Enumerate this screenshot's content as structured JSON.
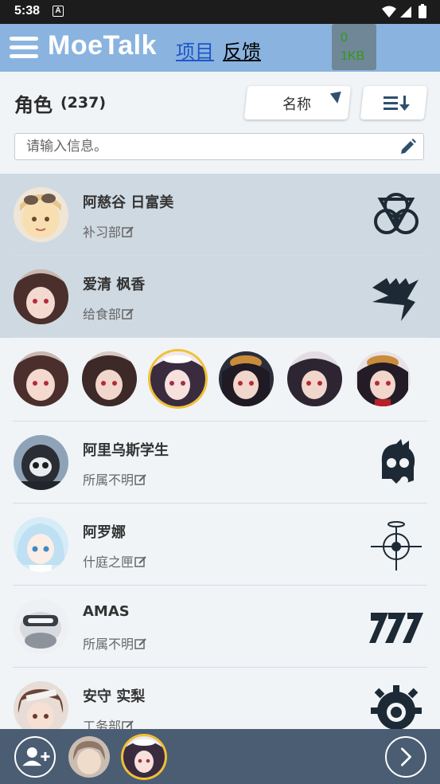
{
  "status_bar": {
    "time": "5:38",
    "notification_badge": "A",
    "icons": [
      "wifi-icon",
      "signal-icon",
      "battery-icon"
    ]
  },
  "header": {
    "logo": "MoeTalk",
    "nav_project": "项目",
    "nav_feedback": "反馈",
    "storage_value": "0",
    "storage_unit": "1KB"
  },
  "section": {
    "title": "角色",
    "count": "(237)",
    "sort_label": "名称"
  },
  "search": {
    "placeholder": "请输入信息。",
    "value": ""
  },
  "characters": [
    {
      "name": "阿慈谷 日富美",
      "club": "补习部",
      "selected": true,
      "avatar": "hifumi",
      "school_icon": "trinity-logo-icon"
    },
    {
      "name": "爱清 枫香",
      "club": "给食部",
      "selected": true,
      "avatar": "fuuka",
      "school_icon": "gehenna-logo-icon"
    },
    {
      "name": "阿里乌斯学生",
      "club": "所属不明",
      "selected": false,
      "avatar": "arius",
      "school_icon": "arius-logo-icon"
    },
    {
      "name": "阿罗娜",
      "club": "什庭之匣",
      "selected": false,
      "avatar": "arona",
      "school_icon": "schale-logo-icon"
    },
    {
      "name": "AMAS",
      "club": "所属不明",
      "selected": false,
      "avatar": "amas",
      "school_icon": "millennium-logo-icon"
    },
    {
      "name": "安守 实梨",
      "club": "工务部",
      "selected": false,
      "avatar": "minori",
      "school_icon": "red-winter-logo-icon"
    }
  ],
  "variants": [
    "fuuka-1",
    "fuuka-2",
    "fuuka-3",
    "fuuka-4",
    "fuuka-5",
    "fuuka-6"
  ],
  "variant_active_index": 2,
  "colors": {
    "header": "#8ab4df",
    "selected_row": "#cfd9e2",
    "bottom_bar": "#4a5d73",
    "active_ring": "#f2c033",
    "nav_link": "#1f56c9"
  }
}
